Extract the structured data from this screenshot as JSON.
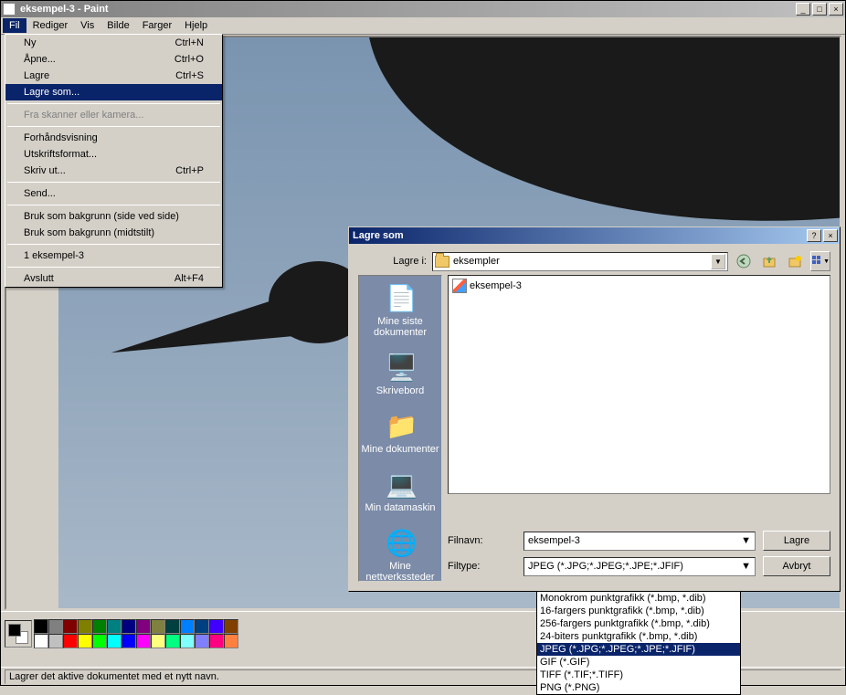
{
  "app": {
    "title": "eksempel-3 - Paint"
  },
  "menubar": {
    "items": [
      "Fil",
      "Rediger",
      "Vis",
      "Bilde",
      "Farger",
      "Hjelp"
    ],
    "open_index": 0
  },
  "fileMenu": {
    "items": [
      {
        "label": "Ny",
        "shortcut": "Ctrl+N",
        "type": "item"
      },
      {
        "label": "Åpne...",
        "shortcut": "Ctrl+O",
        "type": "item"
      },
      {
        "label": "Lagre",
        "shortcut": "Ctrl+S",
        "type": "item"
      },
      {
        "label": "Lagre som...",
        "shortcut": "",
        "type": "item",
        "highlighted": true
      },
      {
        "type": "sep"
      },
      {
        "label": "Fra skanner eller kamera...",
        "shortcut": "",
        "type": "item",
        "disabled": true
      },
      {
        "type": "sep"
      },
      {
        "label": "Forhåndsvisning",
        "shortcut": "",
        "type": "item"
      },
      {
        "label": "Utskriftsformat...",
        "shortcut": "",
        "type": "item"
      },
      {
        "label": "Skriv ut...",
        "shortcut": "Ctrl+P",
        "type": "item"
      },
      {
        "type": "sep"
      },
      {
        "label": "Send...",
        "shortcut": "",
        "type": "item"
      },
      {
        "type": "sep"
      },
      {
        "label": "Bruk som bakgrunn (side ved side)",
        "shortcut": "",
        "type": "item"
      },
      {
        "label": "Bruk som bakgrunn (midtstilt)",
        "shortcut": "",
        "type": "item"
      },
      {
        "type": "sep"
      },
      {
        "label": "1 eksempel-3",
        "shortcut": "",
        "type": "item"
      },
      {
        "type": "sep"
      },
      {
        "label": "Avslutt",
        "shortcut": "Alt+F4",
        "type": "item"
      }
    ]
  },
  "statusbar": {
    "text": "Lagrer det aktive dokumentet med et nytt navn."
  },
  "palette": {
    "row1": [
      "#000000",
      "#808080",
      "#800000",
      "#808000",
      "#008000",
      "#008080",
      "#000080",
      "#800080",
      "#808040",
      "#004040",
      "#0080ff",
      "#004080",
      "#4000ff",
      "#804000"
    ],
    "row2": [
      "#ffffff",
      "#c0c0c0",
      "#ff0000",
      "#ffff00",
      "#00ff00",
      "#00ffff",
      "#0000ff",
      "#ff00ff",
      "#ffff80",
      "#00ff80",
      "#80ffff",
      "#8080ff",
      "#ff0080",
      "#ff8040"
    ]
  },
  "saveDialog": {
    "title": "Lagre som",
    "lookInLabel": "Lagre i:",
    "lookInValue": "eksempler",
    "places": [
      "Mine siste dokumenter",
      "Skrivebord",
      "Mine dokumenter",
      "Min datamaskin",
      "Mine nettverkssteder"
    ],
    "fileItem": "eksempel-3",
    "filenameLabel": "Filnavn:",
    "filenameValue": "eksempel-3",
    "filetypeLabel": "Filtype:",
    "filetypeValue": "JPEG (*.JPG;*.JPEG;*.JPE;*.JFIF)",
    "saveBtn": "Lagre",
    "cancelBtn": "Avbryt"
  },
  "filetypeDropdown": {
    "items": [
      "Monokrom punktgrafikk (*.bmp, *.dib)",
      "16-fargers punktgrafikk (*.bmp, *.dib)",
      "256-fargers punktgrafikk (*.bmp, *.dib)",
      "24-biters punktgrafikk (*.bmp, *.dib)",
      "JPEG (*.JPG;*.JPEG;*.JPE;*.JFIF)",
      "GIF (*.GIF)",
      "TIFF (*.TIF;*.TIFF)",
      "PNG (*.PNG)"
    ],
    "selected_index": 4
  }
}
